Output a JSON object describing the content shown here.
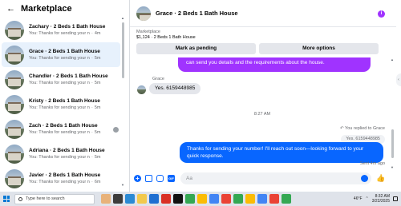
{
  "sidebar": {
    "title": "Marketplace",
    "back_icon": "arrow-left-icon",
    "conversations": [
      {
        "name": "Zachary · 2 Beds 1 Bath House",
        "snippet": "You: Thanks for sending your numb...",
        "time": "4m",
        "active": false
      },
      {
        "name": "Grace · 2 Beds 1 Bath House",
        "snippet": "You: Thanks for sending your numb...",
        "time": "5m",
        "active": true
      },
      {
        "name": "Chandler · 2 Beds 1 Bath House",
        "snippet": "You: Thanks for sending your numb...",
        "time": "5m",
        "active": false
      },
      {
        "name": "Kristy · 2 Beds 1 Bath House",
        "snippet": "You: Thanks for sending your numb...",
        "time": "5m",
        "active": false
      },
      {
        "name": "Zach · 2 Beds 1 Bath House",
        "snippet": "You: Thanks for sending your numb...",
        "time": "5m",
        "active": false
      },
      {
        "name": "Adriana · 2 Beds 1 Bath House",
        "snippet": "You: Thanks for sending your numb...",
        "time": "5m",
        "active": false
      },
      {
        "name": "Javier · 2 Beds 1 Bath House",
        "snippet": "You: Thanks for sending your numb...",
        "time": "6m",
        "active": false
      }
    ]
  },
  "chat": {
    "title": "Grace · 2 Beds 1 Bath House",
    "info_icon": "info-icon",
    "listing_label": "Marketplace",
    "listing_price": "$1,124 · 2 Beds 1 Bath House",
    "mark_pending_label": "Mark as pending",
    "more_options_label": "More options",
    "partial_outgoing": "can send you details and the requirements about the house.",
    "sender_name": "Grace",
    "incoming_message": "Yes. 6159448985",
    "timestamp": "8:27 AM",
    "replied_to": "You replied to Grace",
    "quoted_text": "Yes. 6159448985",
    "outgoing_message": "Thanks for sending your number! I'll reach out soon—looking forward to your quick response.",
    "sent_status": "Sent 4m ago",
    "input_placeholder": "Aa"
  },
  "taskbar": {
    "search_placeholder": "Type here to search",
    "temperature": "46°F",
    "time": "8:32 AM",
    "date": "3/22/2025"
  },
  "colors": {
    "accent_blue": "#0866ff",
    "accent_purple": "#a033ff",
    "selected_bg": "#e7f1fc"
  }
}
